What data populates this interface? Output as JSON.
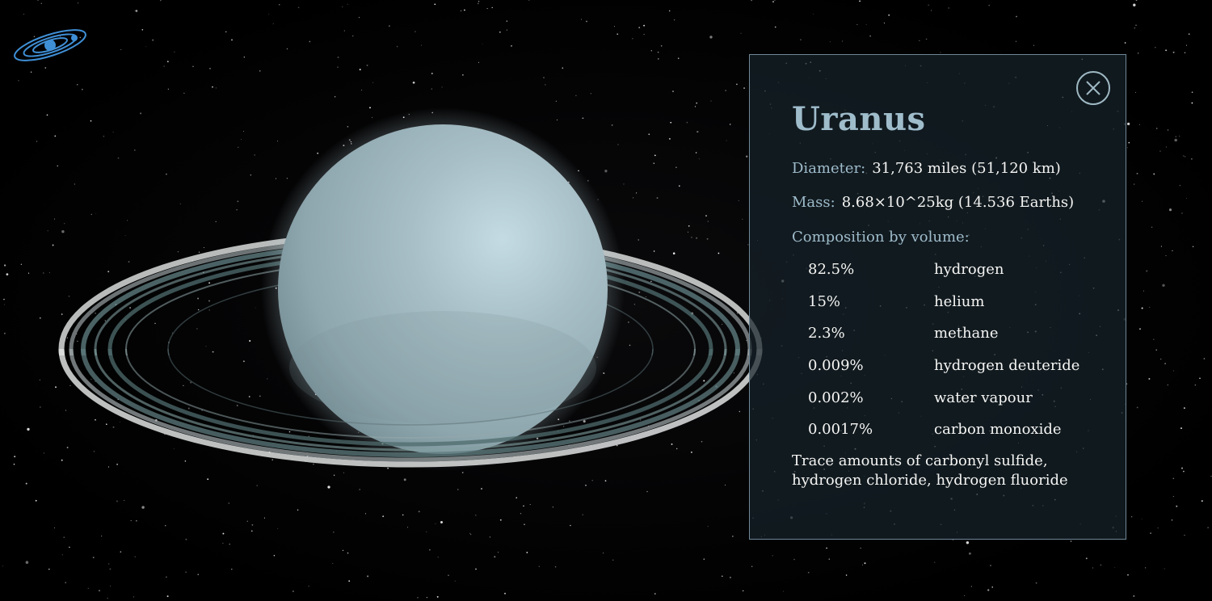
{
  "logo": {
    "icon": "solar-system-icon"
  },
  "panel": {
    "title": "Uranus",
    "close_icon": "close-icon",
    "diameter_label": "Diameter:",
    "diameter_value": "31,763 miles (51,120 km)",
    "mass_label": "Mass:",
    "mass_value": "8.68×10^25kg (14.536 Earths)",
    "composition_heading": "Composition by volume:",
    "composition": [
      {
        "percent": "82.5%",
        "gas": "hydrogen"
      },
      {
        "percent": "15%",
        "gas": "helium"
      },
      {
        "percent": "2.3%",
        "gas": "methane"
      },
      {
        "percent": "0.009%",
        "gas": "hydrogen deuteride"
      },
      {
        "percent": "0.002%",
        "gas": "water vapour"
      },
      {
        "percent": "0.0017%",
        "gas": "carbon monoxide"
      }
    ],
    "trace_note": "Trace amounts of carbonyl sulfide, hydrogen chloride, hydrogen fluoride"
  },
  "colors": {
    "accent": "#9fbccb",
    "panel_border": "#6f8796",
    "planet": "#a9c2c9",
    "logo": "#3f8fd6"
  }
}
